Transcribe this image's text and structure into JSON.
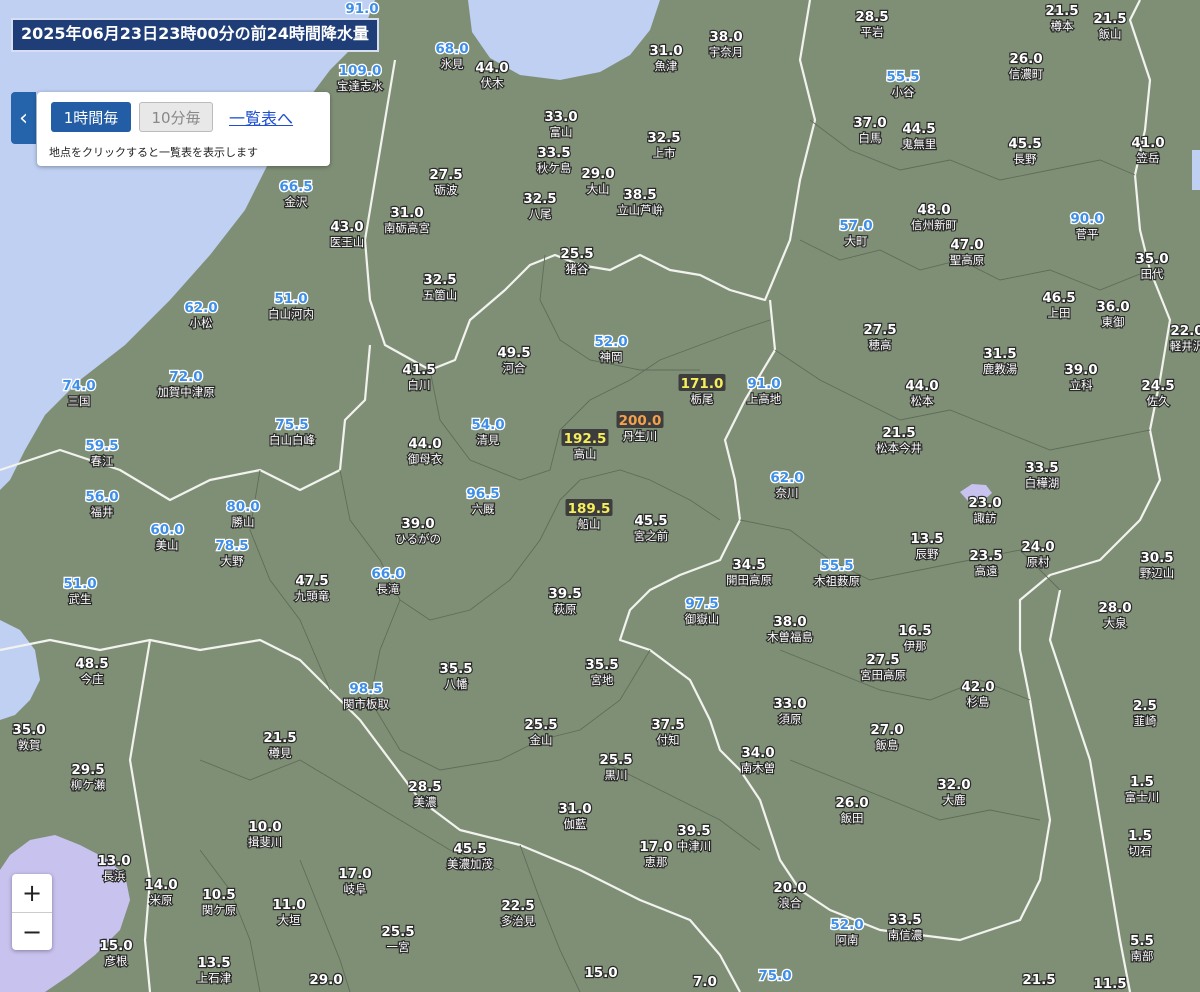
{
  "header": {
    "title": "2025年06月23日23時00分の前24時間降水量"
  },
  "panel": {
    "collapse_icon": "chevron-left-icon",
    "btn_hourly": "1時間毎",
    "btn_10min": "10分毎",
    "list_link": "一覧表へ",
    "note": "地点をクリックすると一覧表を表示します"
  },
  "zoom": {
    "in": "+",
    "out": "−"
  },
  "colors": {
    "land": "#7f8f76",
    "sea": "#bfd0f2",
    "lake": "#c8c2ee",
    "boundary": "#f2f2ee",
    "value_normal": "#ffffff",
    "value_blue": "#3f8fe8",
    "value_yellow": "#f7ee5c",
    "value_orange": "#f4a14c"
  },
  "stations": [
    {
      "v": "91.0",
      "n": "",
      "c": "b"
    },
    {
      "v": "68.0",
      "n": "氷見",
      "c": "b"
    },
    {
      "v": "109.0",
      "n": "宝達志水",
      "c": "b"
    },
    {
      "v": "44.0",
      "n": "伏木",
      "c": "n"
    },
    {
      "v": "31.0",
      "n": "魚津",
      "c": "n"
    },
    {
      "v": "38.0",
      "n": "宇奈月",
      "c": "n"
    },
    {
      "v": "28.5",
      "n": "平岩",
      "c": "n"
    },
    {
      "v": "55.5",
      "n": "小谷",
      "c": "b"
    },
    {
      "v": "21.5",
      "n": "樽本",
      "c": "n"
    },
    {
      "v": "21.5",
      "n": "飯山",
      "c": "n"
    },
    {
      "v": "26.0",
      "n": "信濃町",
      "c": "n"
    },
    {
      "v": "33.0",
      "n": "富山",
      "c": "n"
    },
    {
      "v": "33.5",
      "n": "秋ケ島",
      "c": "n"
    },
    {
      "v": "29.0",
      "n": "大山",
      "c": "n"
    },
    {
      "v": "32.5",
      "n": "上市",
      "c": "n"
    },
    {
      "v": "38.5",
      "n": "立山芦峅",
      "c": "n"
    },
    {
      "v": "37.0",
      "n": "白馬",
      "c": "n"
    },
    {
      "v": "44.5",
      "n": "鬼無里",
      "c": "n"
    },
    {
      "v": "45.5",
      "n": "長野",
      "c": "n"
    },
    {
      "v": "41.0",
      "n": "笠岳",
      "c": "n"
    },
    {
      "v": "66.5",
      "n": "金沢",
      "c": "b"
    },
    {
      "v": "27.5",
      "n": "砺波",
      "c": "n"
    },
    {
      "v": "32.5",
      "n": "八尾",
      "c": "n"
    },
    {
      "v": "43.0",
      "n": "医王山",
      "c": "n"
    },
    {
      "v": "31.0",
      "n": "南砺高宮",
      "c": "n"
    },
    {
      "v": "57.0",
      "n": "大町",
      "c": "b"
    },
    {
      "v": "48.0",
      "n": "信州新町",
      "c": "n"
    },
    {
      "v": "90.0",
      "n": "菅平",
      "c": "b"
    },
    {
      "v": "47.0",
      "n": "聖高原",
      "c": "n"
    },
    {
      "v": "35.0",
      "n": "田代",
      "c": "n"
    },
    {
      "v": "25.5",
      "n": "猪谷",
      "c": "n"
    },
    {
      "v": "32.5",
      "n": "五箇山",
      "c": "n"
    },
    {
      "v": "62.0",
      "n": "小松",
      "c": "b"
    },
    {
      "v": "51.0",
      "n": "白山河内",
      "c": "b"
    },
    {
      "v": "46.5",
      "n": "上田",
      "c": "n"
    },
    {
      "v": "36.0",
      "n": "東御",
      "c": "n"
    },
    {
      "v": "22.0",
      "n": "軽井沢",
      "c": "n"
    },
    {
      "v": "27.5",
      "n": "穂高",
      "c": "n"
    },
    {
      "v": "52.0",
      "n": "神岡",
      "c": "b"
    },
    {
      "v": "49.5",
      "n": "河合",
      "c": "n"
    },
    {
      "v": "41.5",
      "n": "白川",
      "c": "n"
    },
    {
      "v": "31.5",
      "n": "鹿教湯",
      "c": "n"
    },
    {
      "v": "74.0",
      "n": "三国",
      "c": "b"
    },
    {
      "v": "72.0",
      "n": "加賀中津原",
      "c": "b"
    },
    {
      "v": "171.0",
      "n": "栃尾",
      "c": "y"
    },
    {
      "v": "91.0",
      "n": "上高地",
      "c": "b"
    },
    {
      "v": "44.0",
      "n": "松本",
      "c": "n"
    },
    {
      "v": "39.0",
      "n": "立科",
      "c": "n"
    },
    {
      "v": "24.5",
      "n": "佐久",
      "c": "n"
    },
    {
      "v": "75.5",
      "n": "白山白峰",
      "c": "b"
    },
    {
      "v": "54.0",
      "n": "清見",
      "c": "b"
    },
    {
      "v": "200.0",
      "n": "丹生川",
      "c": "o"
    },
    {
      "v": "192.5",
      "n": "高山",
      "c": "y"
    },
    {
      "v": "21.5",
      "n": "松本今井",
      "c": "n"
    },
    {
      "v": "59.5",
      "n": "春江",
      "c": "b"
    },
    {
      "v": "44.0",
      "n": "御母衣",
      "c": "n"
    },
    {
      "v": "33.5",
      "n": "白樺湖",
      "c": "n"
    },
    {
      "v": "62.0",
      "n": "奈川",
      "c": "b"
    },
    {
      "v": "56.0",
      "n": "福井",
      "c": "b"
    },
    {
      "v": "80.0",
      "n": "勝山",
      "c": "b"
    },
    {
      "v": "96.5",
      "n": "六厩",
      "c": "b"
    },
    {
      "v": "189.5",
      "n": "船山",
      "c": "y"
    },
    {
      "v": "45.5",
      "n": "宮之前",
      "c": "n"
    },
    {
      "v": "23.0",
      "n": "諏訪",
      "c": "n"
    },
    {
      "v": "60.0",
      "n": "美山",
      "c": "b"
    },
    {
      "v": "39.0",
      "n": "ひるがの",
      "c": "n"
    },
    {
      "v": "78.5",
      "n": "大野",
      "c": "b"
    },
    {
      "v": "13.5",
      "n": "辰野",
      "c": "n"
    },
    {
      "v": "24.0",
      "n": "原村",
      "c": "n"
    },
    {
      "v": "34.5",
      "n": "開田高原",
      "c": "n"
    },
    {
      "v": "55.5",
      "n": "木祖薮原",
      "c": "b"
    },
    {
      "v": "23.5",
      "n": "高遠",
      "c": "n"
    },
    {
      "v": "30.5",
      "n": "野辺山",
      "c": "n"
    },
    {
      "v": "51.0",
      "n": "武生",
      "c": "b"
    },
    {
      "v": "47.5",
      "n": "九頭竜",
      "c": "n"
    },
    {
      "v": "66.0",
      "n": "長滝",
      "c": "b"
    },
    {
      "v": "39.5",
      "n": "萩原",
      "c": "n"
    },
    {
      "v": "97.5",
      "n": "御嶽山",
      "c": "b"
    },
    {
      "v": "28.0",
      "n": "大泉",
      "c": "n"
    },
    {
      "v": "38.0",
      "n": "木曽福島",
      "c": "n"
    },
    {
      "v": "16.5",
      "n": "伊那",
      "c": "n"
    },
    {
      "v": "48.5",
      "n": "今庄",
      "c": "n"
    },
    {
      "v": "35.5",
      "n": "八幡",
      "c": "n"
    },
    {
      "v": "35.5",
      "n": "宮地",
      "c": "n"
    },
    {
      "v": "98.5",
      "n": "関市板取",
      "c": "b"
    },
    {
      "v": "27.5",
      "n": "宮田高原",
      "c": "n"
    },
    {
      "v": "42.0",
      "n": "杉島",
      "c": "n"
    },
    {
      "v": "33.0",
      "n": "須原",
      "c": "n"
    },
    {
      "v": "35.0",
      "n": "敦賀",
      "c": "n"
    },
    {
      "v": "21.5",
      "n": "樽見",
      "c": "n"
    },
    {
      "v": "25.5",
      "n": "金山",
      "c": "n"
    },
    {
      "v": "37.5",
      "n": "付知",
      "c": "n"
    },
    {
      "v": "27.0",
      "n": "飯島",
      "c": "n"
    },
    {
      "v": "2.5",
      "n": "韮崎",
      "c": "n"
    },
    {
      "v": "29.5",
      "n": "柳ケ瀬",
      "c": "n"
    },
    {
      "v": "34.0",
      "n": "南木曽",
      "c": "n"
    },
    {
      "v": "25.5",
      "n": "黒川",
      "c": "n"
    },
    {
      "v": "28.5",
      "n": "美濃",
      "c": "n"
    },
    {
      "v": "32.0",
      "n": "大鹿",
      "c": "n"
    },
    {
      "v": "1.5",
      "n": "富士川",
      "c": "n"
    },
    {
      "v": "26.0",
      "n": "飯田",
      "c": "n"
    },
    {
      "v": "10.0",
      "n": "揖斐川",
      "c": "n"
    },
    {
      "v": "31.0",
      "n": "伽藍",
      "c": "n"
    },
    {
      "v": "39.5",
      "n": "中津川",
      "c": "n"
    },
    {
      "v": "17.0",
      "n": "恵那",
      "c": "n"
    },
    {
      "v": "45.5",
      "n": "美濃加茂",
      "c": "n"
    },
    {
      "v": "1.5",
      "n": "切石",
      "c": "n"
    },
    {
      "v": "13.0",
      "n": "長浜",
      "c": "n"
    },
    {
      "v": "17.0",
      "n": "岐阜",
      "c": "n"
    },
    {
      "v": "14.0",
      "n": "米原",
      "c": "n"
    },
    {
      "v": "10.5",
      "n": "関ケ原",
      "c": "n"
    },
    {
      "v": "11.0",
      "n": "大垣",
      "c": "n"
    },
    {
      "v": "20.0",
      "n": "浪合",
      "c": "n"
    },
    {
      "v": "22.5",
      "n": "多治見",
      "c": "n"
    },
    {
      "v": "52.0",
      "n": "阿南",
      "c": "b"
    },
    {
      "v": "33.5",
      "n": "南信濃",
      "c": "n"
    },
    {
      "v": "15.0",
      "n": "彦根",
      "c": "n"
    },
    {
      "v": "25.5",
      "n": "一宮",
      "c": "n"
    },
    {
      "v": "5.5",
      "n": "南部",
      "c": "n"
    },
    {
      "v": "13.5",
      "n": "上石津",
      "c": "n"
    },
    {
      "v": "29.0",
      "n": "",
      "c": "n"
    },
    {
      "v": "15.0",
      "n": "",
      "c": "n"
    },
    {
      "v": "7.0",
      "n": "",
      "c": "n"
    },
    {
      "v": "75.0",
      "n": "",
      "c": "b"
    },
    {
      "v": "21.5",
      "n": "",
      "c": "n"
    },
    {
      "v": "11.5",
      "n": "",
      "c": "n"
    }
  ]
}
